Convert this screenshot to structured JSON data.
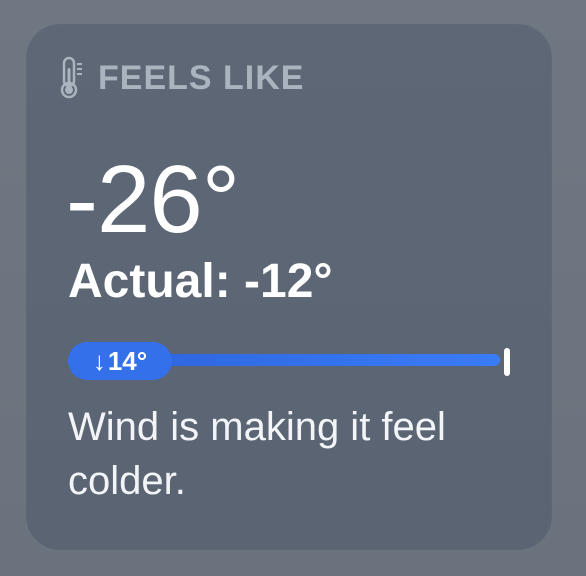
{
  "header": {
    "icon": "thermometer-icon",
    "label": "FEELS LIKE"
  },
  "feels_like": {
    "value": "-26°",
    "actual": "Actual: -12°"
  },
  "range_bar": {
    "low_label": "14°",
    "low_arrow": "↓",
    "accent_color": "#3470ea"
  },
  "description": "Wind is making it feel colder."
}
